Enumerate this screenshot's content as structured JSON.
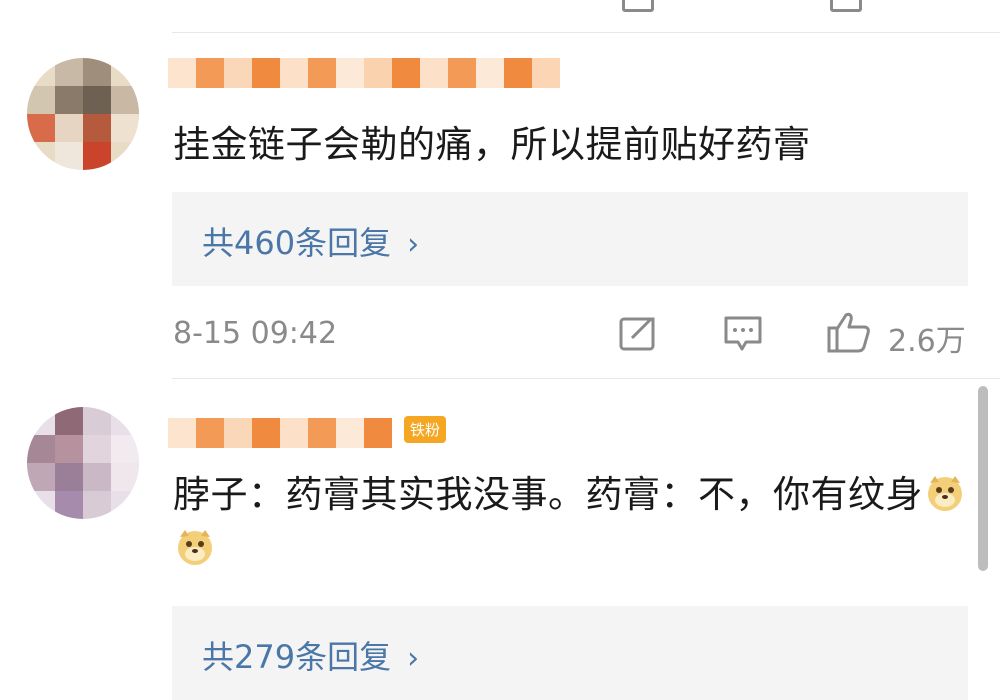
{
  "comments": [
    {
      "text": "挂金链子会勒的痛，所以提前贴好药膏",
      "replies_label": "共460条回复",
      "time": "8-15 09:42",
      "likes": "2.6万"
    },
    {
      "badge": "铁粉",
      "text": "脖子：药膏其实我没事。药膏：不，你有纹身",
      "replies_label": "共279条回复"
    }
  ],
  "icons": {
    "repost": "share-icon",
    "comment": "comment-icon",
    "like": "thumbs-up-icon",
    "reply_chevron": "chevron-right-icon",
    "emoji": "doge-emoji-icon"
  },
  "colors": {
    "link": "#4a76a8",
    "meta": "#8a8a8a",
    "reply_bg": "#f4f4f4",
    "badge": "#f5a623"
  }
}
